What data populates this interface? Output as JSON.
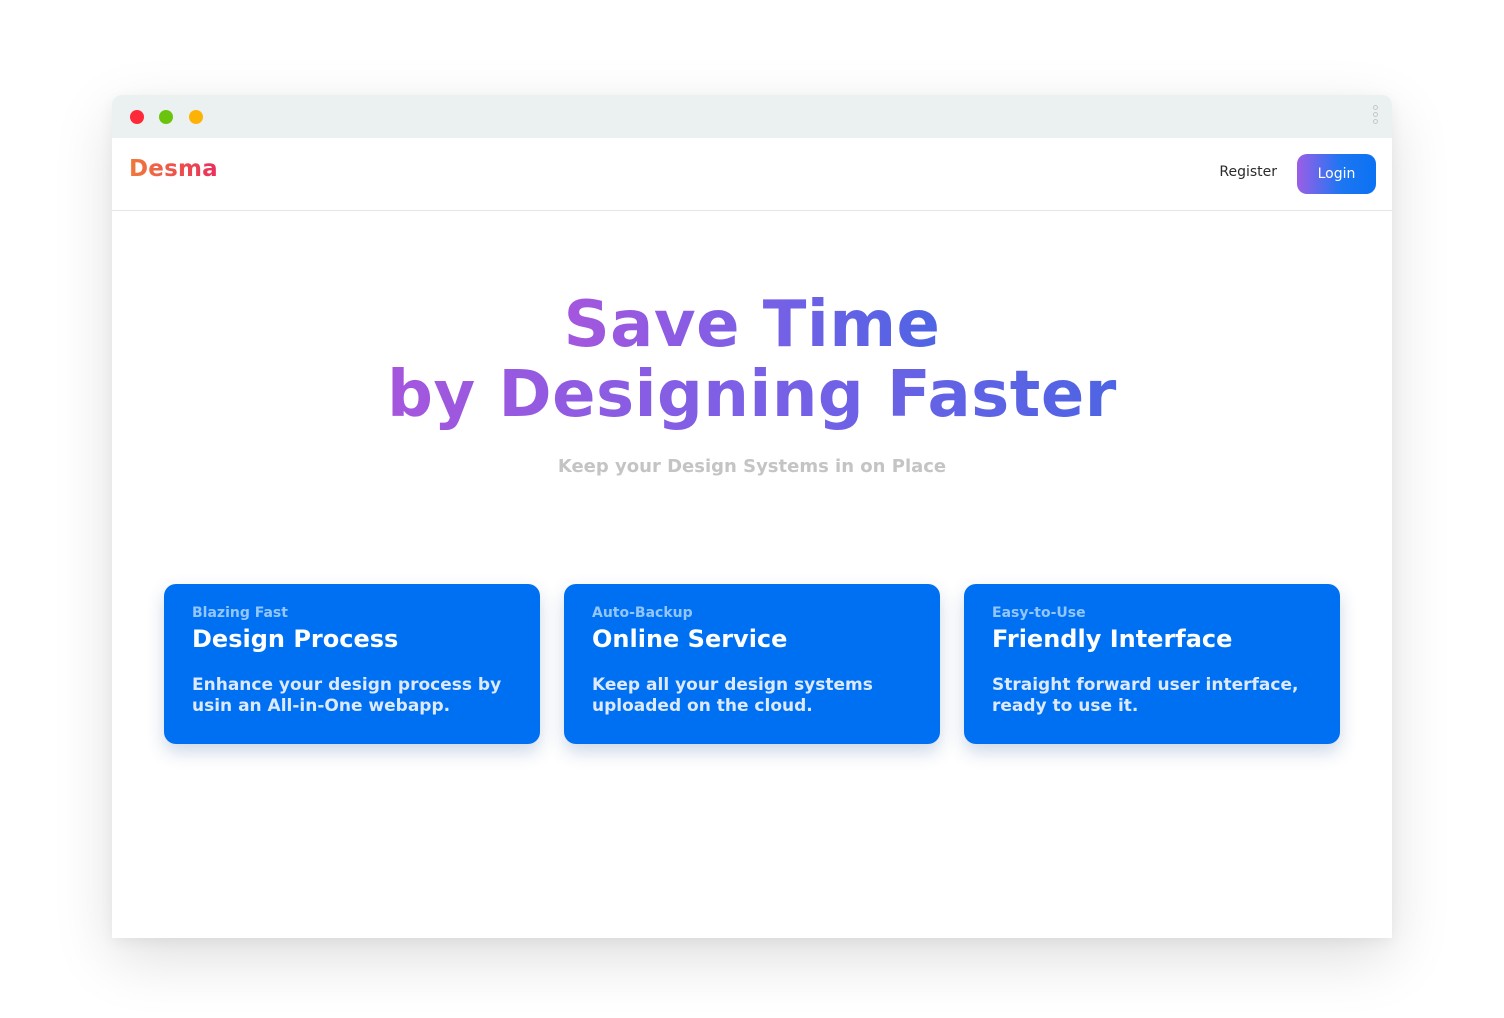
{
  "brand": {
    "name": "Desma",
    "gradient": [
      "#f07a3a",
      "#ea2e5c"
    ]
  },
  "window": {
    "controls": [
      "close-dot",
      "maximize-dot",
      "minimize-dot"
    ],
    "colors": {
      "close": "#fe2a39",
      "maximize": "#6ac40e",
      "minimize": "#fdb305"
    }
  },
  "nav": {
    "register_label": "Register",
    "login_label": "Login"
  },
  "hero": {
    "title_line1": "Save Time",
    "title_line2": "by Designing Faster",
    "subtitle": "Keep your Design Systems in on Place",
    "title_gradient": [
      "#a556dd",
      "#4d64e4"
    ]
  },
  "features": [
    {
      "kicker": "Blazing Fast",
      "title": "Design Process",
      "desc_line1": "Enhance your design process by",
      "desc_line2": "usin an All-in-One webapp."
    },
    {
      "kicker": "Auto-Backup",
      "title": "Online Service",
      "desc_line1": "Keep all your design systems",
      "desc_line2": "uploaded on the cloud."
    },
    {
      "kicker": "Easy-to-Use",
      "title": "Friendly Interface",
      "desc_line1": "Straight forward user interface,",
      "desc_line2": "ready to use it."
    }
  ],
  "colors": {
    "accent": "#0070f2",
    "subtitle": "#c4c4c4"
  }
}
